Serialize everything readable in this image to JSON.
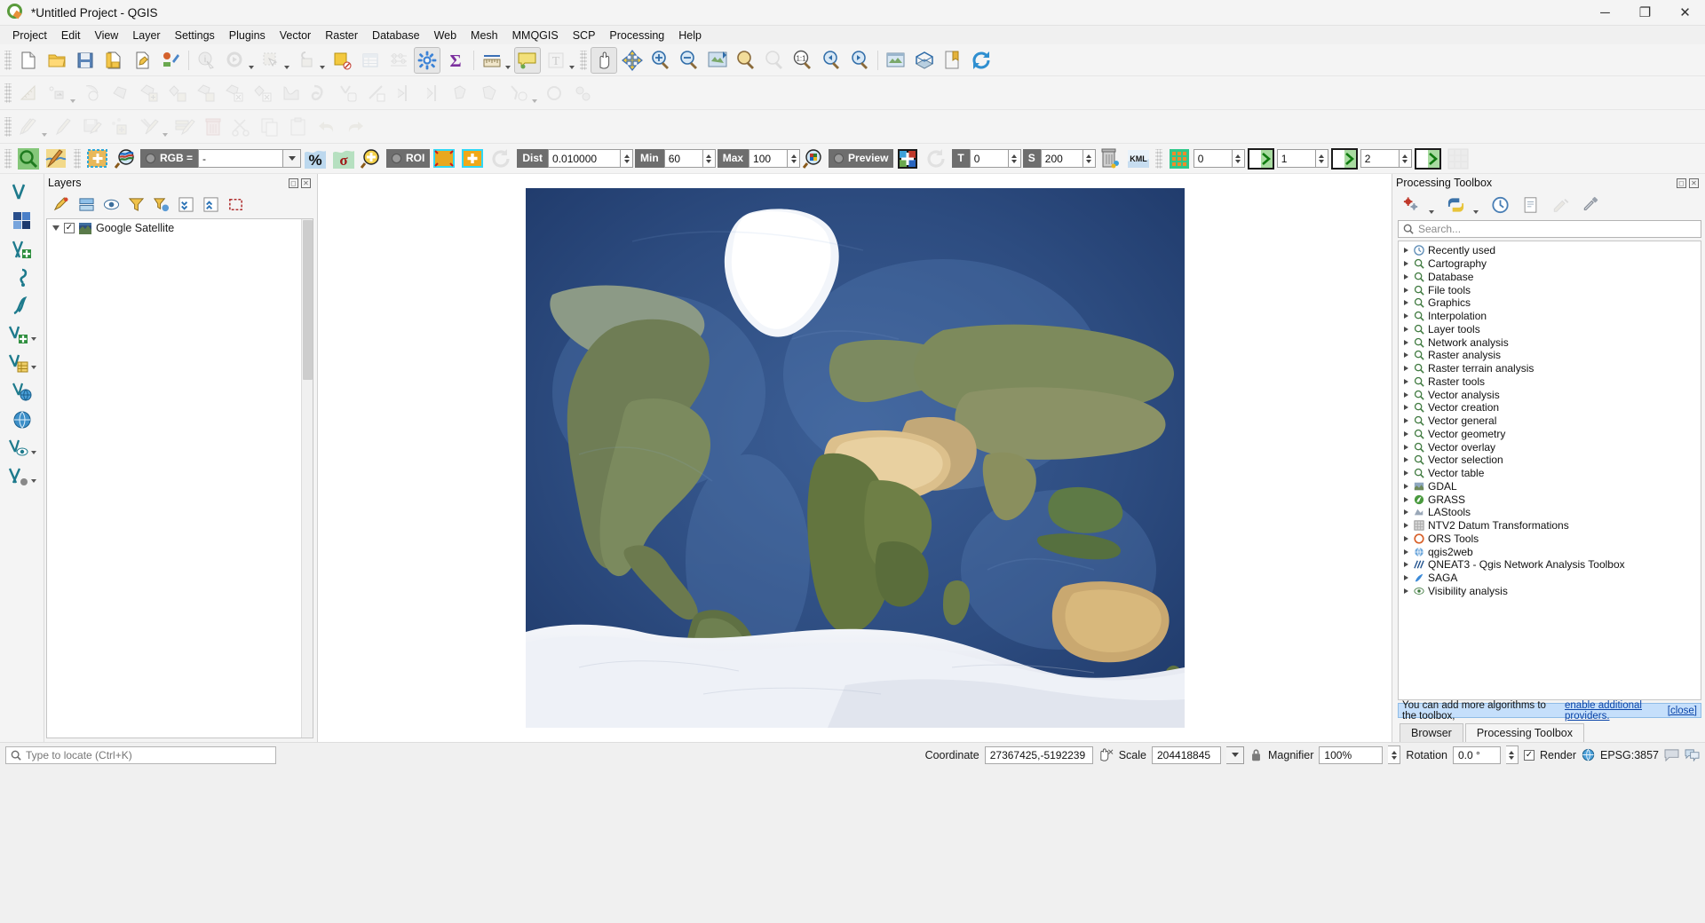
{
  "window": {
    "title": "*Untitled Project - QGIS",
    "logo_icon": "qgis-logo-icon",
    "minimize_label": "─",
    "maximize_label": "❐",
    "close_label": "✕"
  },
  "menubar": {
    "items": [
      {
        "label": "Project",
        "accel": "j"
      },
      {
        "label": "Edit",
        "accel": "E"
      },
      {
        "label": "View",
        "accel": "V"
      },
      {
        "label": "Layer",
        "accel": "L"
      },
      {
        "label": "Settings",
        "accel": "S"
      },
      {
        "label": "Plugins",
        "accel": "P"
      },
      {
        "label": "Vector",
        "accel": "o"
      },
      {
        "label": "Raster",
        "accel": "R"
      },
      {
        "label": "Database",
        "accel": "D"
      },
      {
        "label": "Web",
        "accel": "W"
      },
      {
        "label": "Mesh",
        "accel": "M"
      },
      {
        "label": "MMQGIS",
        "accel": ""
      },
      {
        "label": "SCP",
        "accel": ""
      },
      {
        "label": "Processing",
        "accel": ""
      },
      {
        "label": "Help",
        "accel": "H"
      }
    ]
  },
  "project_toolbar": {
    "buttons": [
      {
        "name": "new-project-icon",
        "tip": "New Project"
      },
      {
        "name": "open-project-icon",
        "tip": "Open Project"
      },
      {
        "name": "save-project-icon",
        "tip": "Save Project"
      },
      {
        "name": "save-project-as-icon",
        "tip": "Save Project As"
      },
      {
        "name": "new-print-layout-icon",
        "tip": "New Print Layout"
      },
      {
        "name": "style-manager-icon",
        "tip": "Style Manager"
      },
      {
        "name": "identify-features-icon",
        "tip": "Identify Features"
      },
      {
        "name": "run-feature-action-icon",
        "tip": "Run Feature Action"
      },
      {
        "name": "select-features-icon",
        "tip": "Select Features"
      },
      {
        "name": "deselect-features-icon",
        "tip": "Deselect Features"
      },
      {
        "name": "select-value-icon",
        "tip": "Select by Value"
      },
      {
        "name": "open-attribute-table-icon",
        "tip": "Open Attribute Table"
      },
      {
        "name": "field-calculator-icon",
        "tip": "Field Calculator"
      },
      {
        "name": "processing-toolbox-icon",
        "tip": "Toolbox"
      },
      {
        "name": "statistical-summary-icon",
        "tip": "Statistical Summary"
      },
      {
        "name": "measure-line-icon",
        "tip": "Measure Line"
      },
      {
        "name": "map-tips-icon",
        "tip": "Show Map Tips"
      },
      {
        "name": "text-annotation-icon",
        "tip": "Text Annotation"
      },
      {
        "name": "pan-map-icon",
        "tip": "Pan Map"
      },
      {
        "name": "pan-to-selection-icon",
        "tip": "Pan Map to Selection"
      },
      {
        "name": "zoom-in-icon",
        "tip": "Zoom In"
      },
      {
        "name": "zoom-out-icon",
        "tip": "Zoom Out"
      },
      {
        "name": "zoom-full-icon",
        "tip": "Zoom Full"
      },
      {
        "name": "zoom-to-selection-icon",
        "tip": "Zoom to Selection"
      },
      {
        "name": "zoom-to-layer-icon",
        "tip": "Zoom to Layer"
      },
      {
        "name": "zoom-to-native-icon",
        "tip": "Zoom to Native Resolution"
      },
      {
        "name": "zoom-last-icon",
        "tip": "Zoom Last"
      },
      {
        "name": "zoom-next-icon",
        "tip": "Zoom Next"
      },
      {
        "name": "new-map-view-icon",
        "tip": "New Map View"
      },
      {
        "name": "new-3d-map-view-icon",
        "tip": "New 3D Map View"
      },
      {
        "name": "show-bookmarks-icon",
        "tip": "Show Bookmarks"
      },
      {
        "name": "refresh-icon",
        "tip": "Refresh"
      }
    ]
  },
  "scp_toolbar": {
    "rgb_label": "RGB =",
    "rgb_value": "-",
    "roi_label": "ROI",
    "preview_label": "Preview",
    "dist_label": "Dist",
    "dist_value": "0.010000",
    "min_label": "Min",
    "min_value": "60",
    "max_label": "Max",
    "max_value": "100",
    "t_label": "T",
    "t_value": "0",
    "s_label": "S",
    "s_value": "200",
    "kml_label": "KML",
    "grid_value_1": "0",
    "grid_value_2": "1",
    "grid_value_3": "2"
  },
  "layers_panel": {
    "title": "Layers",
    "toolbar": [
      {
        "name": "open-layer-styling-icon"
      },
      {
        "name": "add-group-icon"
      },
      {
        "name": "manage-visibility-icon"
      },
      {
        "name": "filter-legend-icon"
      },
      {
        "name": "filter-legend-expression-icon"
      },
      {
        "name": "expand-all-icon"
      },
      {
        "name": "collapse-all-icon"
      },
      {
        "name": "remove-layer-icon"
      }
    ],
    "layers": [
      {
        "name": "Google Satellite",
        "checked": true,
        "expanded": false
      }
    ]
  },
  "map": {
    "layer_name": "Google Satellite",
    "background": "#ffffff"
  },
  "processing_panel": {
    "title": "Processing Toolbox",
    "toolbar": [
      {
        "name": "models-icon"
      },
      {
        "name": "python-scripts-icon"
      },
      {
        "name": "history-icon"
      },
      {
        "name": "results-viewer-icon"
      },
      {
        "name": "edit-features-in-place-icon"
      },
      {
        "name": "options-icon"
      }
    ],
    "search_placeholder": "Search...",
    "tree": [
      {
        "label": "Recently used",
        "icon": "clock-icon"
      },
      {
        "label": "Cartography",
        "icon": "qgis-algo-icon"
      },
      {
        "label": "Database",
        "icon": "qgis-algo-icon"
      },
      {
        "label": "File tools",
        "icon": "qgis-algo-icon"
      },
      {
        "label": "Graphics",
        "icon": "qgis-algo-icon"
      },
      {
        "label": "Interpolation",
        "icon": "qgis-algo-icon"
      },
      {
        "label": "Layer tools",
        "icon": "qgis-algo-icon"
      },
      {
        "label": "Network analysis",
        "icon": "qgis-algo-icon"
      },
      {
        "label": "Raster analysis",
        "icon": "qgis-algo-icon"
      },
      {
        "label": "Raster terrain analysis",
        "icon": "qgis-algo-icon"
      },
      {
        "label": "Raster tools",
        "icon": "qgis-algo-icon"
      },
      {
        "label": "Vector analysis",
        "icon": "qgis-algo-icon"
      },
      {
        "label": "Vector creation",
        "icon": "qgis-algo-icon"
      },
      {
        "label": "Vector general",
        "icon": "qgis-algo-icon"
      },
      {
        "label": "Vector geometry",
        "icon": "qgis-algo-icon"
      },
      {
        "label": "Vector overlay",
        "icon": "qgis-algo-icon"
      },
      {
        "label": "Vector selection",
        "icon": "qgis-algo-icon"
      },
      {
        "label": "Vector table",
        "icon": "qgis-algo-icon"
      },
      {
        "label": "GDAL",
        "icon": "gdal-icon"
      },
      {
        "label": "GRASS",
        "icon": "grass-icon"
      },
      {
        "label": "LAStools",
        "icon": "lastools-icon"
      },
      {
        "label": "NTV2 Datum Transformations",
        "icon": "ntv2-icon"
      },
      {
        "label": "ORS Tools",
        "icon": "ors-icon"
      },
      {
        "label": "qgis2web",
        "icon": "qgis2web-icon"
      },
      {
        "label": "QNEAT3 - Qgis Network Analysis Toolbox",
        "icon": "qneat3-icon"
      },
      {
        "label": "SAGA",
        "icon": "saga-icon"
      },
      {
        "label": "Visibility analysis",
        "icon": "visibility-icon"
      }
    ],
    "notice_text": "You can add more algorithms to the toolbox,",
    "notice_link": "enable additional providers.",
    "notice_close": "[close]",
    "tabs": [
      {
        "label": "Browser",
        "active": false
      },
      {
        "label": "Processing Toolbox",
        "active": true
      }
    ]
  },
  "statusbar": {
    "locate_placeholder": "Type to locate (Ctrl+K)",
    "coordinate_label": "Coordinate",
    "coordinate_value": "27367425,-5192239",
    "scale_label": "Scale",
    "scale_value": "204418845",
    "magnifier_label": "Magnifier",
    "magnifier_value": "100%",
    "rotation_label": "Rotation",
    "rotation_value": "0.0 °",
    "render_label": "Render",
    "render_checked": true,
    "crs_label": "EPSG:3857",
    "messages_icon": "message-log-icon",
    "lock_icon": "lock-icon",
    "globe_icon": "crs-globe-icon"
  },
  "colors": {
    "accent": "#3b7dd8",
    "panel_bg": "#f4f4f4",
    "toolbar_bg": "#f4f4f4",
    "notice_bg": "#c5dffb",
    "ocean": "#2b4a80",
    "land": "#6e7a4a"
  }
}
